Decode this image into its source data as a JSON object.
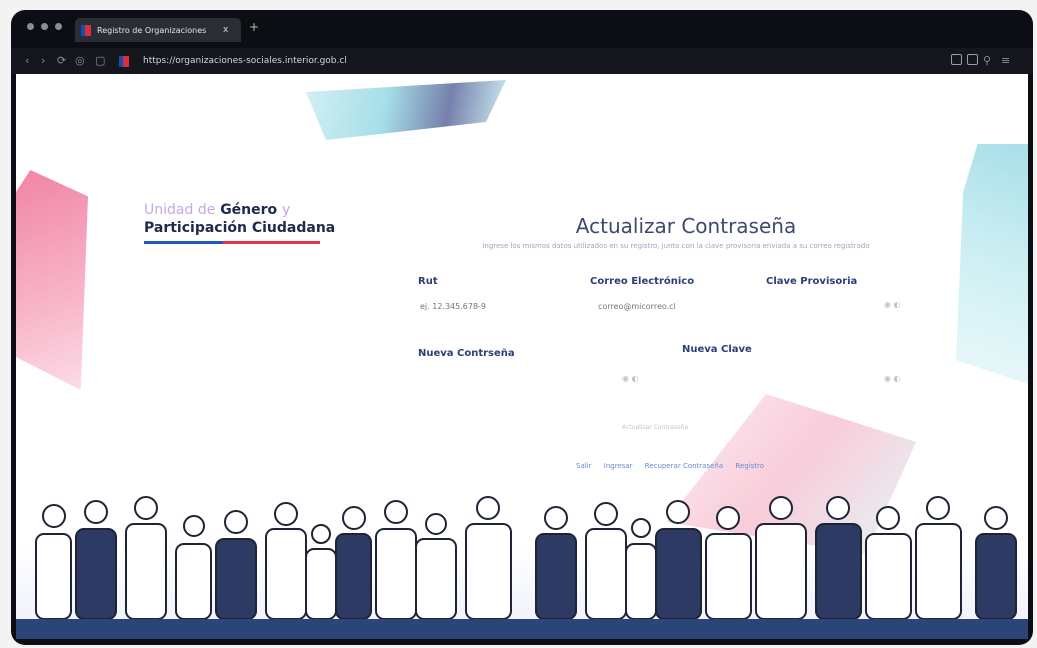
{
  "browser": {
    "tab_title": "Registro de Organizaciones",
    "tab_close": "x",
    "new_tab": "+",
    "url": "https://organizaciones-sociales.interior.gob.cl"
  },
  "logo": {
    "prefix": "Unidad de",
    "genero": "Género",
    "connector": "y",
    "line2": "Participación Ciudadana"
  },
  "form": {
    "title": "Actualizar Contraseña",
    "subtitle": "Ingrese los mismos datos utilizados en su registro, junto con la clave provisoria enviada a su correo registrado",
    "rut_label": "Rut",
    "rut_placeholder": "ej. 12.345.678-9",
    "email_label": "Correo Electrónico",
    "email_placeholder": "correo@micorreo.cl",
    "temp_label": "Clave Provisoria",
    "new_pass_label": "Nueva Contrseña",
    "new_pass2_label": "Nueva Clave",
    "submit_label": "Actualizar Contraseña"
  },
  "links": [
    "Salir",
    "Ingresar",
    "Recuperar Contraseña",
    "Registro"
  ],
  "colors": {
    "accent_blue": "#2c3e7a",
    "footer": "#2d4478",
    "logo_red": "#e3364a",
    "logo_blue": "#1f5ab8"
  }
}
